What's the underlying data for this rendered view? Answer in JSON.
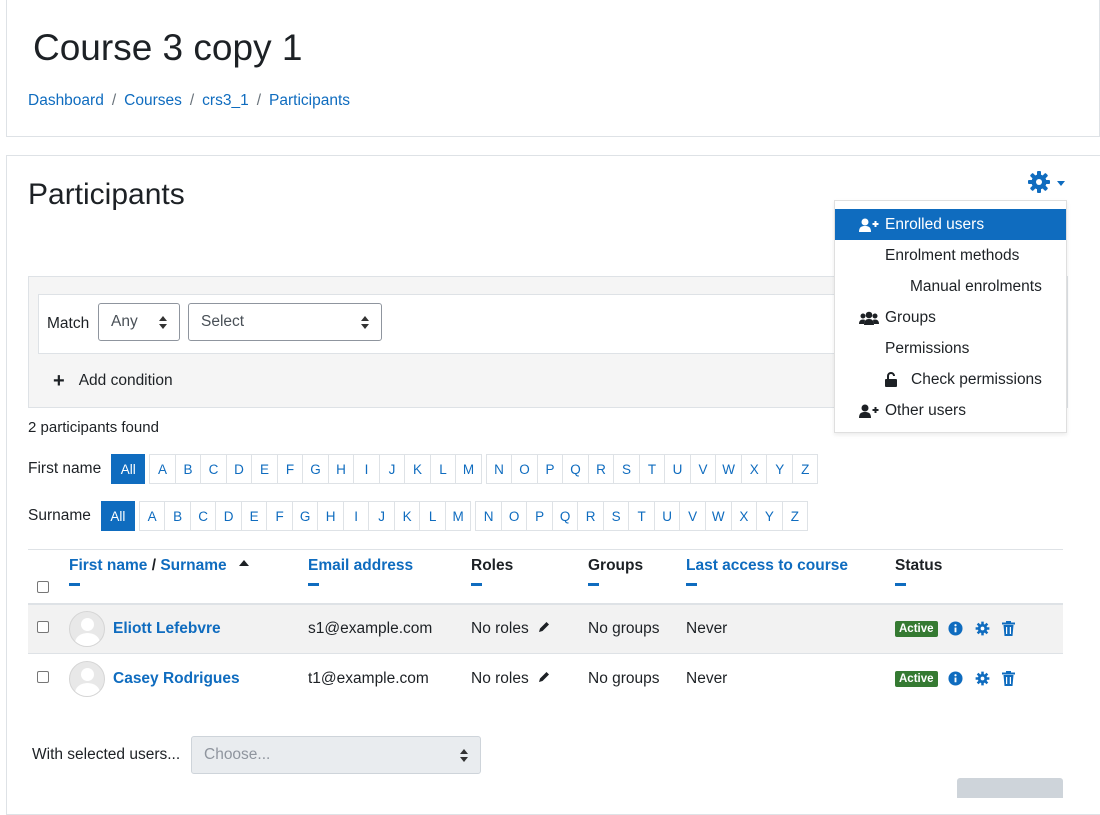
{
  "header": {
    "course_title": "Course 3 copy 1",
    "breadcrumb": [
      "Dashboard",
      "Courses",
      "crs3_1",
      "Participants"
    ]
  },
  "main": {
    "heading": "Participants",
    "filter": {
      "match_label": "Match",
      "match_value": "Any",
      "select_value": "Select",
      "add_condition": "Add condition"
    },
    "found_text": "2 participants found",
    "firstname_label": "First name",
    "surname_label": "Surname",
    "all_label": "All",
    "letters": [
      "A",
      "B",
      "C",
      "D",
      "E",
      "F",
      "G",
      "H",
      "I",
      "J",
      "K",
      "L",
      "M",
      "N",
      "O",
      "P",
      "Q",
      "R",
      "S",
      "T",
      "U",
      "V",
      "W",
      "X",
      "Y",
      "Z"
    ],
    "table": {
      "col_firstname": "First name",
      "col_sep": "/",
      "col_surname": "Surname",
      "col_email": "Email address",
      "col_roles": "Roles",
      "col_groups": "Groups",
      "col_lastaccess": "Last access to course",
      "col_status": "Status",
      "rows": [
        {
          "name": "Eliott Lefebvre",
          "email": "s1@example.com",
          "roles": "No roles",
          "groups": "No groups",
          "last_access": "Never",
          "status": "Active"
        },
        {
          "name": "Casey Rodrigues",
          "email": "t1@example.com",
          "roles": "No roles",
          "groups": "No groups",
          "last_access": "Never",
          "status": "Active"
        }
      ]
    },
    "with_selected_label": "With selected users...",
    "with_selected_placeholder": "Choose..."
  },
  "dropdown": {
    "items": [
      {
        "label": "Enrolled users",
        "icon": "user-plus-icon",
        "active": true
      },
      {
        "label": "Enrolment methods"
      },
      {
        "label": "Manual enrolments"
      },
      {
        "label": "Groups",
        "icon": "users-icon"
      },
      {
        "label": "Permissions"
      },
      {
        "label": "Check permissions",
        "icon": "unlock-icon"
      },
      {
        "label": "Other users",
        "icon": "user-plus-icon"
      }
    ]
  },
  "colors": {
    "link": "#0f6cbf",
    "active_badge": "#357a32",
    "striped_row": "#f2f2f2"
  }
}
